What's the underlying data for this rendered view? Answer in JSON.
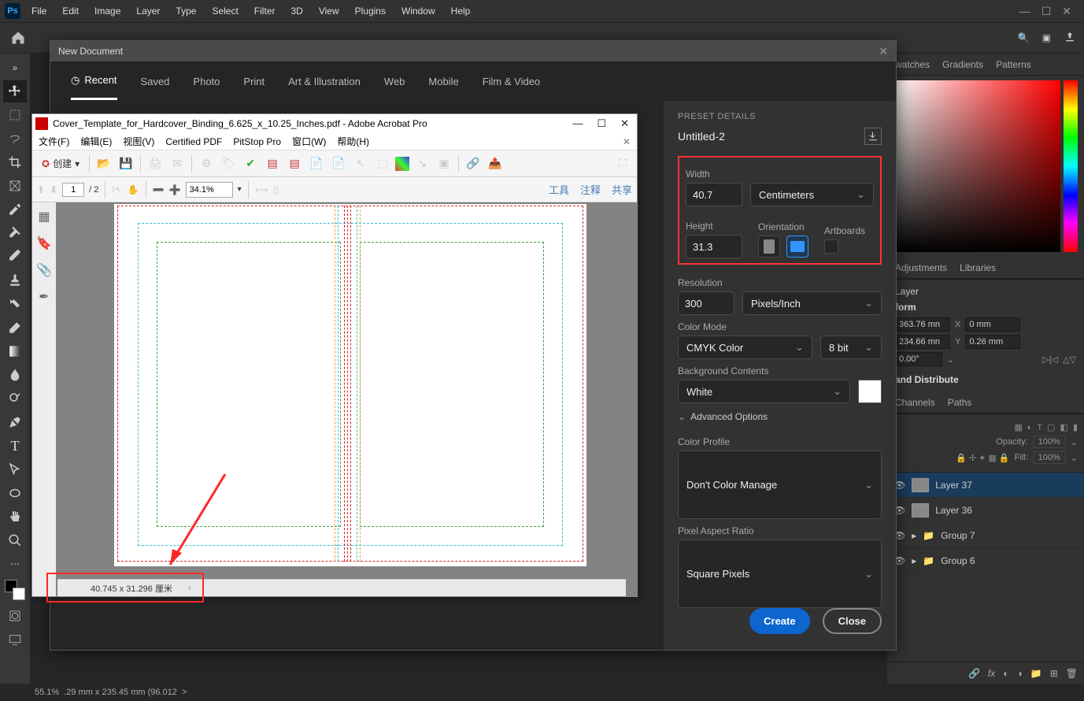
{
  "menu": {
    "items": [
      "File",
      "Edit",
      "Image",
      "Layer",
      "Type",
      "Select",
      "Filter",
      "3D",
      "View",
      "Plugins",
      "Window",
      "Help"
    ]
  },
  "win": {
    "min": "—",
    "max": "☐",
    "close": "✕"
  },
  "status": {
    "zoom": "55.1%",
    "info": ".29 mm x 235.45 mm (96.012",
    "chev": ">"
  },
  "panel_tabs_top": [
    "watches",
    "Gradients",
    "Patterns"
  ],
  "panel_tabs_mid": [
    "Adjustments",
    "Libraries"
  ],
  "props": {
    "layer": "Layer",
    "form": "form",
    "w": "363.76 mn",
    "x": "0 mm",
    "h": "234.66 mn",
    "y": "0.26 mm",
    "ang": "0.00°",
    "align": "and Distribute",
    "X": "X",
    "Y": "Y"
  },
  "layers_tabs": [
    "Channels",
    "Paths"
  ],
  "layers": {
    "opacityLabel": "Opacity:",
    "opacity": "100%",
    "fillLabel": "Fill:",
    "fill": "100%",
    "items": [
      {
        "name": "Layer 37",
        "sel": true
      },
      {
        "name": "Layer 36"
      },
      {
        "name": "Group 7",
        "group": true
      },
      {
        "name": "Group 6",
        "group": true
      }
    ]
  },
  "new_doc": {
    "title": "New Document",
    "tabs": [
      "Recent",
      "Saved",
      "Photo",
      "Print",
      "Art & Illustration",
      "Web",
      "Mobile",
      "Film & Video"
    ],
    "preset_details": "PRESET DETAILS",
    "name": "Untitled-2",
    "widthLabel": "Width",
    "width": "40.7",
    "unit": "Centimeters",
    "heightLabel": "Height",
    "height": "31.3",
    "orientationLabel": "Orientation",
    "artboardsLabel": "Artboards",
    "resolutionLabel": "Resolution",
    "resolution": "300",
    "resUnit": "Pixels/Inch",
    "colorModeLabel": "Color Mode",
    "colorMode": "CMYK Color",
    "bitDepth": "8 bit",
    "bgLabel": "Background Contents",
    "bg": "White",
    "advanced": "Advanced Options",
    "colorProfileLabel": "Color Profile",
    "colorProfile": "Don't Color Manage",
    "aspectLabel": "Pixel Aspect Ratio",
    "aspect": "Square Pixels",
    "create": "Create",
    "close": "Close",
    "chev": "⌄"
  },
  "acrobat": {
    "title": "Cover_Template_for_Hardcover_Binding_6.625_x_10.25_Inches.pdf - Adobe Acrobat Pro",
    "menu": [
      "文件(F)",
      "编辑(E)",
      "视图(V)",
      "Certified PDF",
      "PitStop Pro",
      "窗口(W)",
      "帮助(H)"
    ],
    "create": "创建",
    "createChev": "▾",
    "page": "1",
    "pages": "/ 2",
    "zoom": "34.1%",
    "zoomChev": "▾",
    "links": [
      "工具",
      "注释",
      "共享"
    ],
    "status": "40.745 x 31.296 厘米",
    "statusChev": "‹",
    "win": {
      "min": "—",
      "max": "☐",
      "close": "✕"
    }
  },
  "icons": {
    "clock": "◷",
    "portrait": "▯",
    "landscape": "▭",
    "dl": "⇩",
    "expand": "⌄",
    "search": "🔍",
    "frame": "▣",
    "share": "⇪",
    "home": "⌂",
    "link": "🔗",
    "fx": "fx",
    "mask": "◐",
    "folder": "📁",
    "new": "▦",
    "trash": "🗑"
  }
}
